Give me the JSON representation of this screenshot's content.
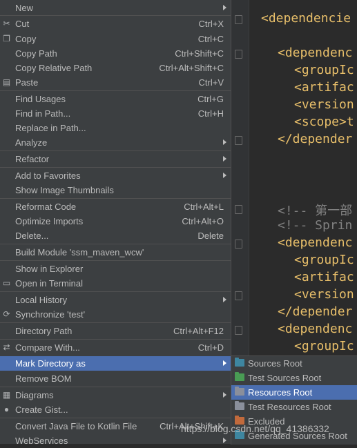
{
  "menu": {
    "items": [
      {
        "label": "New",
        "shortcut": "",
        "submenu": true,
        "icon": ""
      },
      {
        "label": "Cut",
        "shortcut": "Ctrl+X",
        "submenu": false,
        "icon": "scissors-icon"
      },
      {
        "label": "Copy",
        "shortcut": "Ctrl+C",
        "submenu": false,
        "icon": "copy-icon"
      },
      {
        "label": "Copy Path",
        "shortcut": "Ctrl+Shift+C",
        "submenu": false,
        "icon": ""
      },
      {
        "label": "Copy Relative Path",
        "shortcut": "Ctrl+Alt+Shift+C",
        "submenu": false,
        "icon": ""
      },
      {
        "label": "Paste",
        "shortcut": "Ctrl+V",
        "submenu": false,
        "icon": "clipboard-icon"
      },
      {
        "label": "Find Usages",
        "shortcut": "Ctrl+G",
        "submenu": false,
        "icon": ""
      },
      {
        "label": "Find in Path...",
        "shortcut": "Ctrl+H",
        "submenu": false,
        "icon": ""
      },
      {
        "label": "Replace in Path...",
        "shortcut": "",
        "submenu": false,
        "icon": ""
      },
      {
        "label": "Analyze",
        "shortcut": "",
        "submenu": true,
        "icon": ""
      },
      {
        "label": "Refactor",
        "shortcut": "",
        "submenu": true,
        "icon": ""
      },
      {
        "label": "Add to Favorites",
        "shortcut": "",
        "submenu": true,
        "icon": ""
      },
      {
        "label": "Show Image Thumbnails",
        "shortcut": "",
        "submenu": false,
        "icon": ""
      },
      {
        "label": "Reformat Code",
        "shortcut": "Ctrl+Alt+L",
        "submenu": false,
        "icon": ""
      },
      {
        "label": "Optimize Imports",
        "shortcut": "Ctrl+Alt+O",
        "submenu": false,
        "icon": ""
      },
      {
        "label": "Delete...",
        "shortcut": "Delete",
        "submenu": false,
        "icon": ""
      },
      {
        "label": "Build Module 'ssm_maven_wcw'",
        "shortcut": "",
        "submenu": false,
        "icon": ""
      },
      {
        "label": "Show in Explorer",
        "shortcut": "",
        "submenu": false,
        "icon": ""
      },
      {
        "label": "Open in Terminal",
        "shortcut": "",
        "submenu": false,
        "icon": "terminal-icon"
      },
      {
        "label": "Local History",
        "shortcut": "",
        "submenu": true,
        "icon": ""
      },
      {
        "label": "Synchronize 'test'",
        "shortcut": "",
        "submenu": false,
        "icon": "sync-icon"
      },
      {
        "label": "Directory Path",
        "shortcut": "Ctrl+Alt+F12",
        "submenu": false,
        "icon": ""
      },
      {
        "label": "Compare With...",
        "shortcut": "Ctrl+D",
        "submenu": false,
        "icon": "compare-icon"
      },
      {
        "label": "Mark Directory as",
        "shortcut": "",
        "submenu": true,
        "icon": ""
      },
      {
        "label": "Remove BOM",
        "shortcut": "",
        "submenu": false,
        "icon": ""
      },
      {
        "label": "Diagrams",
        "shortcut": "",
        "submenu": true,
        "icon": "diagram-icon"
      },
      {
        "label": "Create Gist...",
        "shortcut": "",
        "submenu": false,
        "icon": "github-icon"
      },
      {
        "label": "Convert Java File to Kotlin File",
        "shortcut": "Ctrl+Alt+Shift+K",
        "submenu": false,
        "icon": ""
      },
      {
        "label": "WebServices",
        "shortcut": "",
        "submenu": true,
        "icon": ""
      }
    ]
  },
  "submenu": {
    "items": [
      {
        "label": "Sources Root",
        "color": "#3e86a0"
      },
      {
        "label": "Test Sources Root",
        "color": "#499c54"
      },
      {
        "label": "Resources Root",
        "color": "#8a8f9b"
      },
      {
        "label": "Test Resources Root",
        "color": "#8a8f9b"
      },
      {
        "label": "Excluded",
        "color": "#c26a3c"
      },
      {
        "label": "Generated Sources Root",
        "color": "#3e86a0"
      }
    ]
  },
  "editor": {
    "lines": [
      "<dependencie",
      "<dependenc",
      "<groupIc",
      "<artifac",
      "<version",
      "<scope>t",
      "</depender",
      "<!-- 第一部",
      "<!-- Sprin",
      "<dependenc",
      "<groupIc",
      "<artifac",
      "<version",
      "</depender",
      "<dependenc",
      "<groupIc"
    ]
  },
  "watermark": "https://blog.csdn.net/qq_41386332"
}
